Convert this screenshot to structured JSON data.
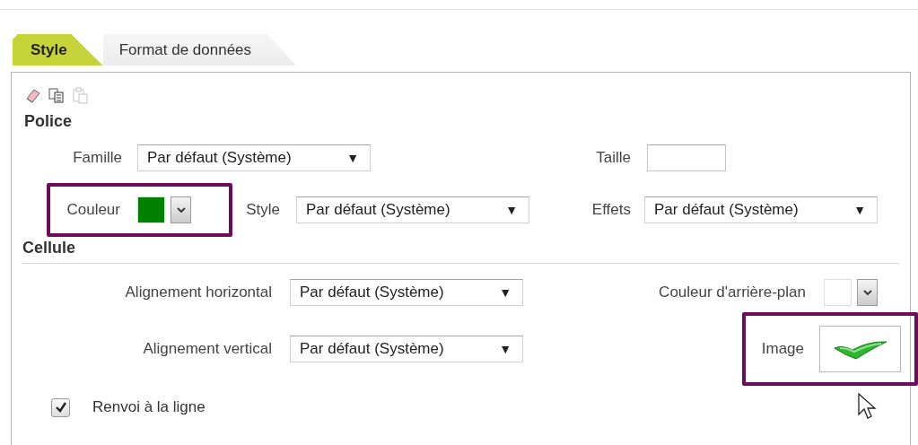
{
  "tabs": [
    {
      "label": "Style",
      "selected": true
    },
    {
      "label": "Format de données",
      "selected": false
    }
  ],
  "toolbar": [
    {
      "kind": "eraser",
      "disabled": false
    },
    {
      "kind": "copy",
      "disabled": false
    },
    {
      "kind": "paste",
      "disabled": true
    }
  ],
  "sections": [
    {
      "title": "Police",
      "rows": [
        [
          {
            "kind": "select",
            "label": "Famille",
            "value": "Par défaut (Système)",
            "arrow": "▼"
          },
          "",
          {
            "kind": "text",
            "label": "Taille"
          }
        ],
        [
          {
            "kind": "color",
            "label": "Couleur",
            "color": "#008000",
            "highlighted": true
          },
          {
            "kind": "select",
            "label": "Style",
            "value": "Par défaut (Système)",
            "arrow": "▼"
          },
          {
            "kind": "select",
            "label": "Effets",
            "value": "Par défaut (Système)",
            "arrow": "▼"
          }
        ]
      ]
    },
    {
      "title": "Cellule",
      "rows": [
        [
          {
            "kind": "select",
            "label": "Alignement horizontal",
            "value": "Par défaut (Système)",
            "arrow": "▼"
          },
          {
            "kind": "color",
            "label": "Couleur d'arrière-plan",
            "color": "#ffffff"
          }
        ],
        [
          {
            "kind": "select",
            "label": "Alignement vertical",
            "value": "Par défaut (Système)",
            "arrow": "▼"
          },
          {
            "kind": "image",
            "label": "Image",
            "highlighted": true
          }
        ],
        [
          {
            "kind": "checkbox",
            "label": "Renvoi à la ligne",
            "checked": true
          }
        ]
      ]
    }
  ]
}
